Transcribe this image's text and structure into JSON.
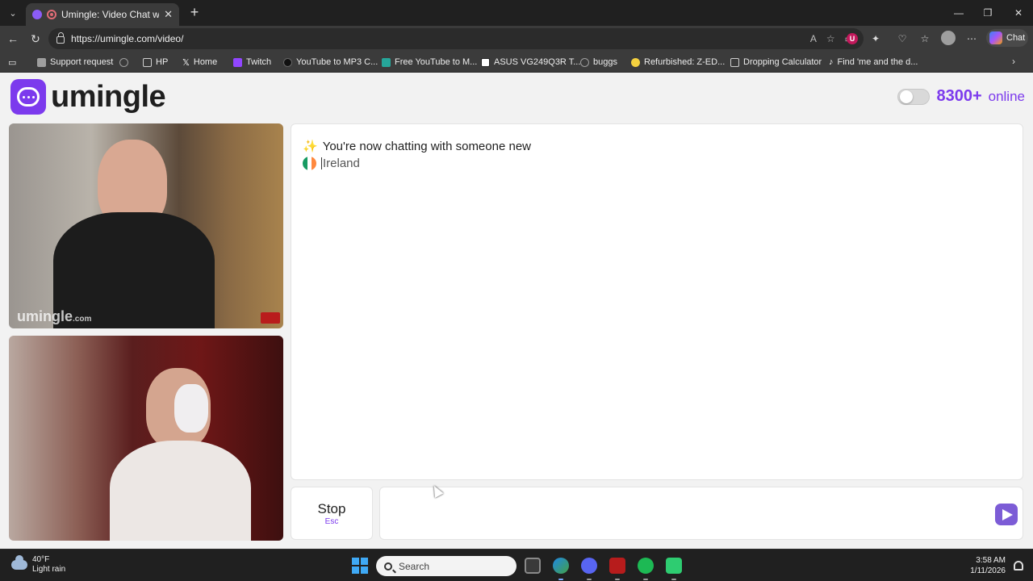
{
  "browser": {
    "tab_title": "Umingle: Video Chat with Stra",
    "tab_close": "✕",
    "new_tab": "+",
    "url": "https://umingle.com/video/",
    "copilot_label": "Chat",
    "window_controls": {
      "minimize": "—",
      "restore": "❐",
      "close": "✕"
    }
  },
  "bookmarks": [
    {
      "label": "Support request",
      "icon": "clipboard-icon",
      "color": "#9e9e9e"
    },
    {
      "label": "",
      "icon": "globe-icon",
      "color": "#9e9e9e"
    },
    {
      "label": "HP",
      "icon": "folder-icon",
      "color": "#9e9e9e"
    },
    {
      "label": "Home",
      "icon": "x-logo-icon",
      "color": "#ffffff"
    },
    {
      "label": "Twitch",
      "icon": "twitch-icon",
      "color": "#9146ff"
    },
    {
      "label": "YouTube to MP3 C...",
      "icon": "converter-icon",
      "color": "#222222"
    },
    {
      "label": "Free YouTube to M...",
      "icon": "ytm-icon",
      "color": "#26a69a"
    },
    {
      "label": "ASUS VG249Q3R T...",
      "icon": "notion-icon",
      "color": "#ffffff"
    },
    {
      "label": "buggs",
      "icon": "globe-icon",
      "color": "#9e9e9e"
    },
    {
      "label": "Refurbished: Z-ED...",
      "icon": "lemon-icon",
      "color": "#f4d03f"
    },
    {
      "label": "Dropping Calculator",
      "icon": "calculator-icon",
      "color": "#9e9e9e"
    },
    {
      "label": "Find 'me and the d...",
      "icon": "tiktok-icon",
      "color": "#ffffff"
    }
  ],
  "site": {
    "logo_text": "umingle",
    "online_count": "8300+",
    "online_label": "online",
    "brand_color": "#7c3aed"
  },
  "video": {
    "watermark": "umingle",
    "watermark_suffix": ".com"
  },
  "chat": {
    "intro": "You're now chatting with someone new",
    "country": "Ireland",
    "flag_colors": [
      "#169b62",
      "#ffffff",
      "#ff883e"
    ]
  },
  "controls": {
    "stop_label": "Stop",
    "stop_hint": "Esc",
    "message_placeholder": ""
  },
  "taskbar": {
    "temperature": "40°F",
    "weather": "Light rain",
    "search_placeholder": "Search",
    "time": "3:58 AM",
    "date": "1/11/2026"
  }
}
